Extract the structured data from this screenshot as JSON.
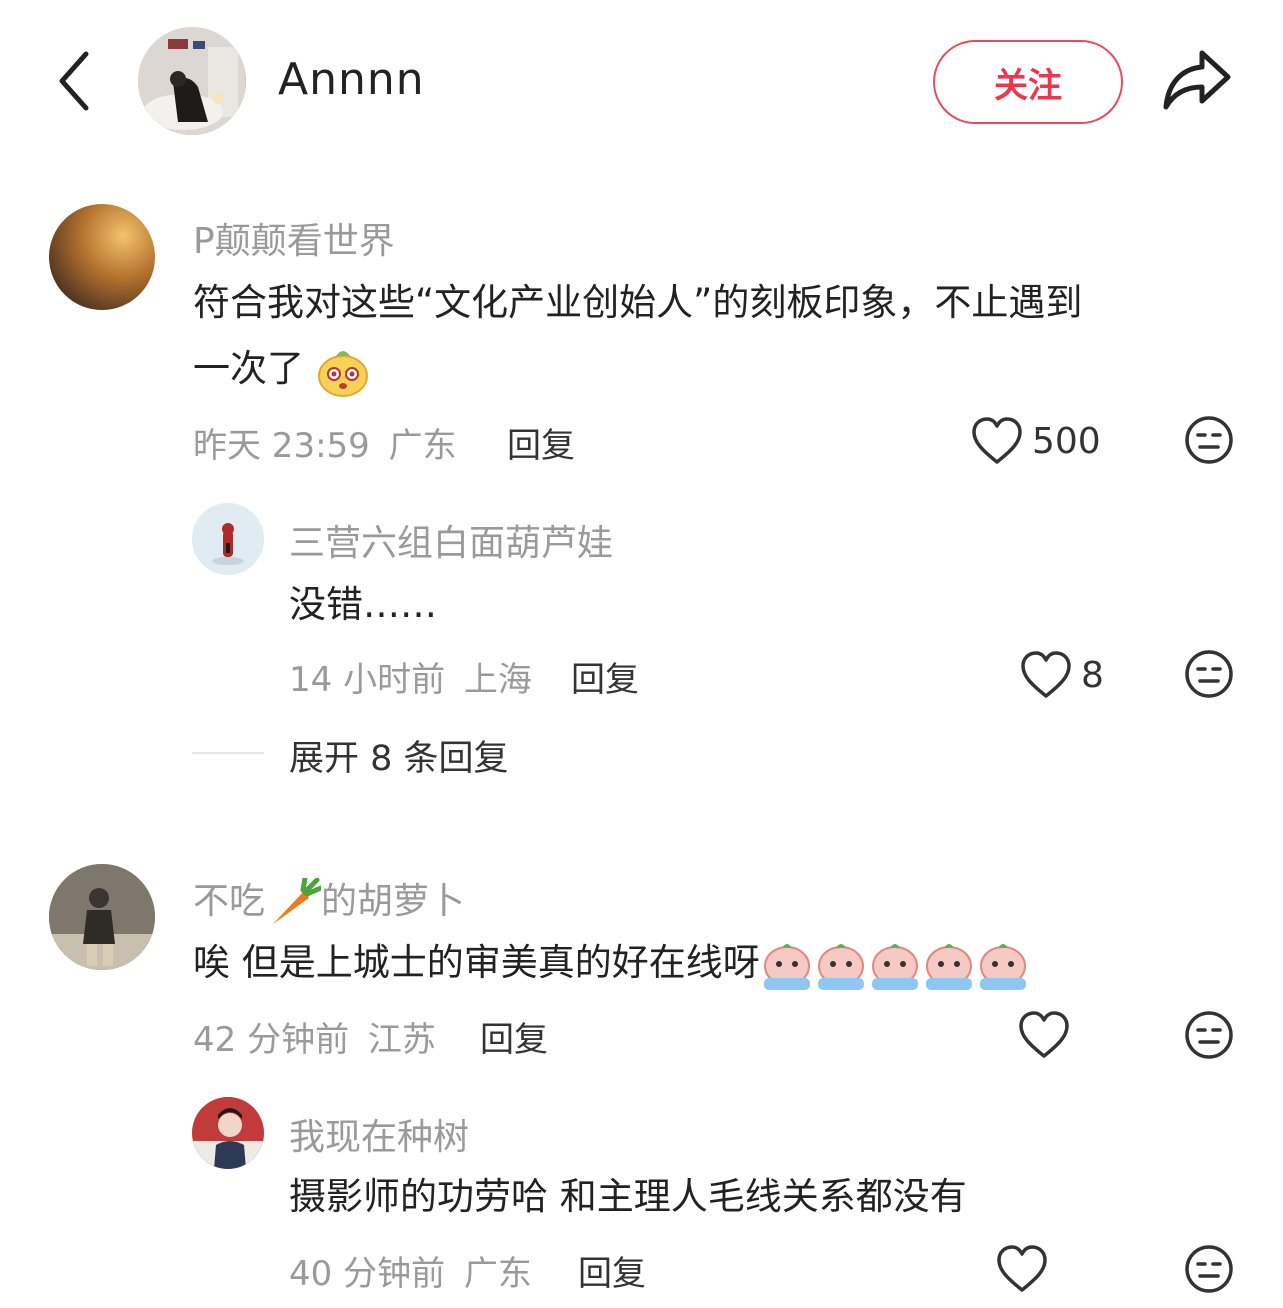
{
  "header": {
    "username": "Annnn",
    "follow_label": "关注"
  },
  "comments": [
    {
      "username": "P颠颠看世界",
      "content_line1": "符合我对这些“文化产业创始人”的刻板印象，不止遇到",
      "content_line2": "一次了",
      "time": "昨天 23:59",
      "location": "广东",
      "reply_label": "回复",
      "likes": "500"
    },
    {
      "username": "三营六组白面葫芦娃",
      "content": "没错……",
      "time": "14 小时前",
      "location": "上海",
      "reply_label": "回复",
      "likes": "8"
    },
    {
      "username_part1": "不吃",
      "username_part2": "的胡萝卜",
      "content": "唉 但是上城士的审美真的好在线呀",
      "time": "42 分钟前",
      "location": "江苏",
      "reply_label": "回复"
    },
    {
      "username": "我现在种树",
      "content": "摄影师的功劳哈 和主理人毛线关系都没有",
      "time": "40 分钟前",
      "location": "广东",
      "reply_label": "回复"
    }
  ],
  "expand_label": "展开 8 条回复",
  "icons": {
    "back": "chevron-left-icon",
    "share": "share-icon",
    "like": "heart-icon",
    "dislike": "neutral-face-icon"
  },
  "colors": {
    "accent": "#e8384d",
    "muted": "#9a9a9a"
  }
}
